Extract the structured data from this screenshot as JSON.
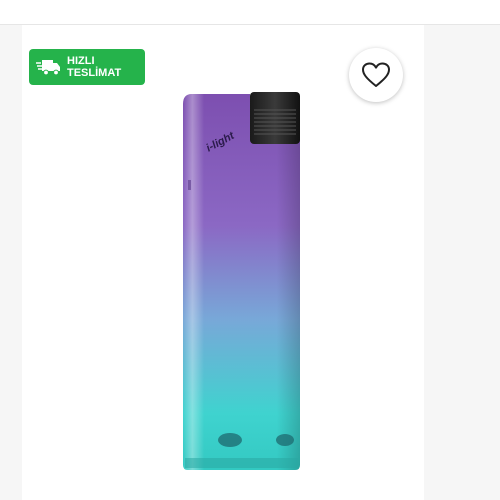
{
  "badge": {
    "line1": "HIZLI",
    "line2": "TESLİMAT",
    "icon": "delivery-truck-icon",
    "color": "#25b34b"
  },
  "favorite": {
    "icon": "heart-outline-icon"
  },
  "product": {
    "brand_mark": "i-light",
    "gradient_top": "#8a5bb8",
    "gradient_bottom": "#39d6cc"
  }
}
